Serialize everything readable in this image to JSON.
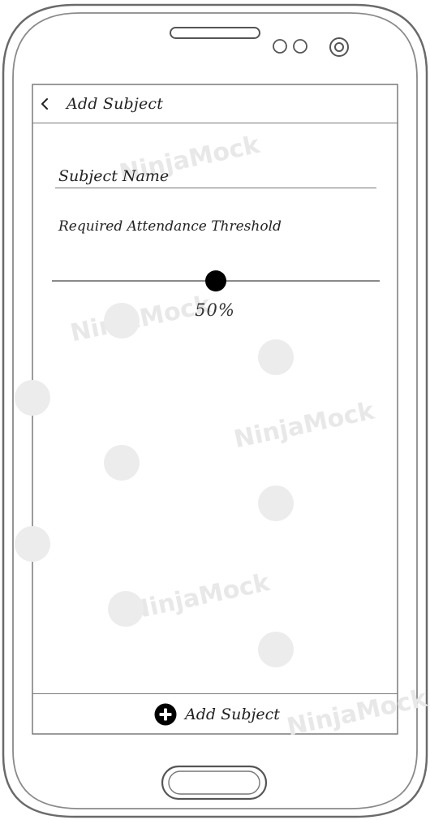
{
  "header": {
    "title": "Add Subject",
    "back_icon": "chevron-left-icon"
  },
  "form": {
    "subject_name_placeholder": "Subject Name",
    "subject_name_value": "",
    "threshold_label": "Required Attendance Threshold",
    "threshold_value": 50,
    "threshold_display": "50%"
  },
  "footer": {
    "add_label": "Add Subject",
    "add_icon": "plus-circle-icon"
  },
  "watermark": {
    "brand": "NinjaMock"
  },
  "colors": {
    "outline": "#555555",
    "thumb": "#000000",
    "track": "#8a8a8a",
    "watermark": "#e6e6e6"
  }
}
